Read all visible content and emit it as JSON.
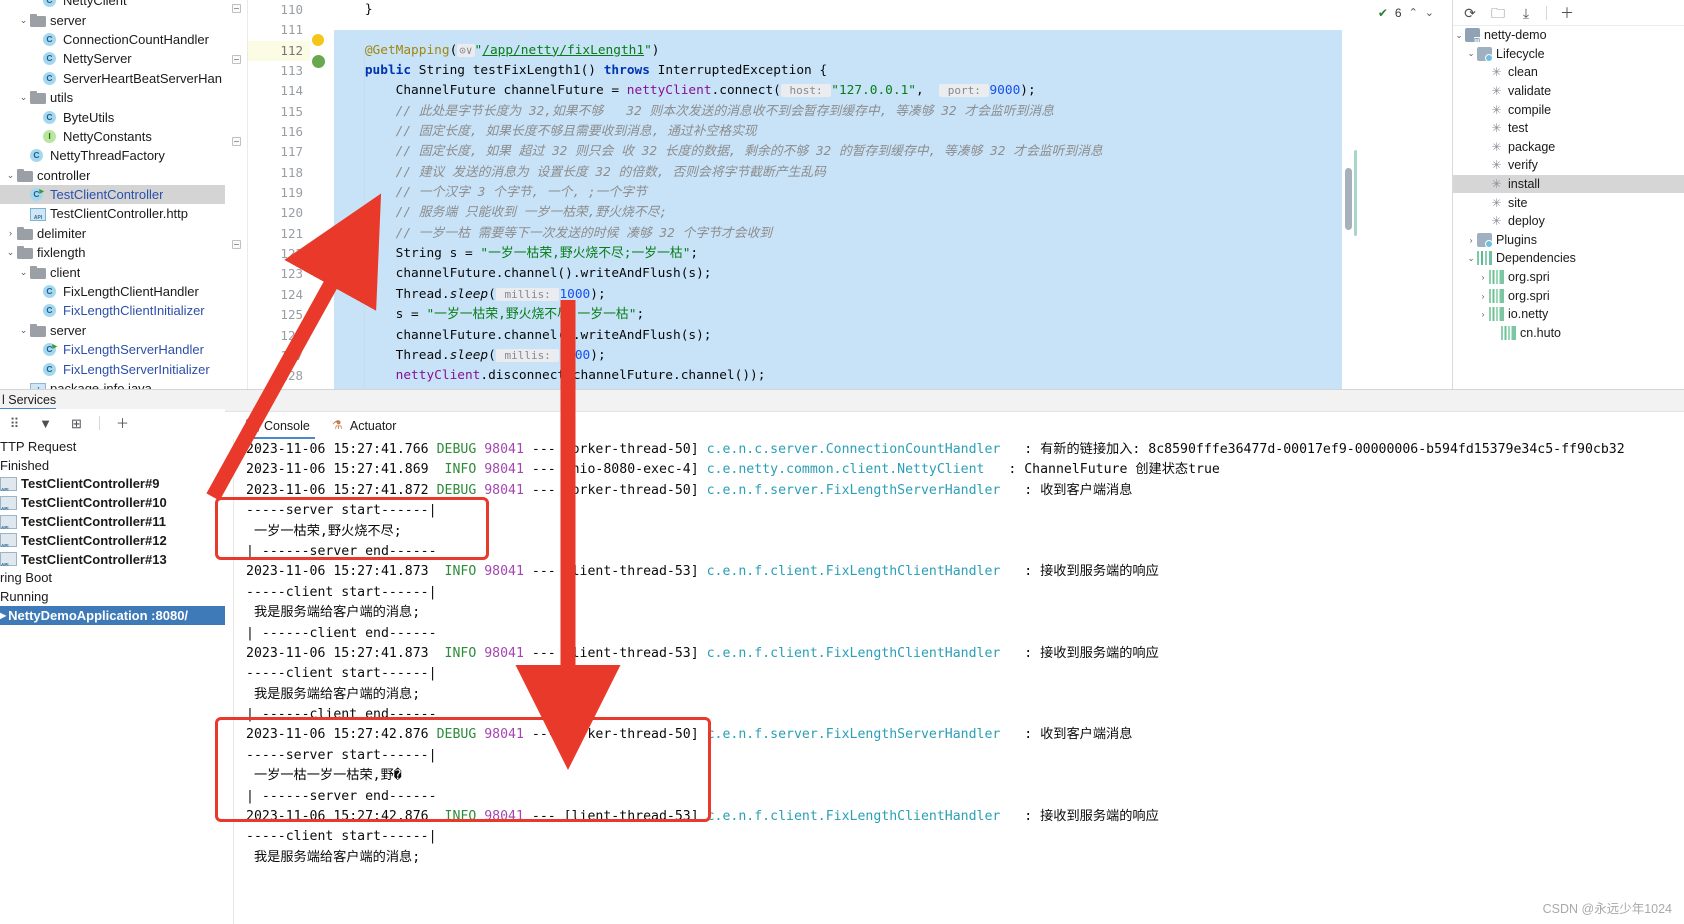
{
  "project_tree": {
    "rows": [
      {
        "indent": 2,
        "twisty": "",
        "icon": "class-icon",
        "label": "NettyClient",
        "blue": false,
        "clipped_top": true
      },
      {
        "indent": 1,
        "twisty": "v",
        "icon": "folder-icon",
        "label": "server",
        "blue": false
      },
      {
        "indent": 2,
        "twisty": "",
        "icon": "class-icon",
        "label": "ConnectionCountHandler",
        "blue": false
      },
      {
        "indent": 2,
        "twisty": "",
        "icon": "class-icon",
        "label": "NettyServer",
        "blue": false
      },
      {
        "indent": 2,
        "twisty": "",
        "icon": "class-icon",
        "label": "ServerHeartBeatServerHan",
        "blue": false
      },
      {
        "indent": 1,
        "twisty": "v",
        "icon": "folder-icon",
        "label": "utils",
        "blue": false
      },
      {
        "indent": 2,
        "twisty": "",
        "icon": "class-icon",
        "label": "ByteUtils",
        "blue": false
      },
      {
        "indent": 2,
        "twisty": "",
        "icon": "interface-icon",
        "label": "NettyConstants",
        "blue": false
      },
      {
        "indent": 1,
        "twisty": "",
        "icon": "class-icon",
        "label": "NettyThreadFactory",
        "blue": false
      },
      {
        "indent": 0,
        "twisty": "v",
        "icon": "folder-icon",
        "label": "controller",
        "blue": false
      },
      {
        "indent": 1,
        "twisty": "",
        "icon": "class-runnable-icon",
        "label": "TestClientController",
        "blue": true,
        "selected": true
      },
      {
        "indent": 1,
        "twisty": "",
        "icon": "http-file-icon",
        "label": "TestClientController.http",
        "blue": false
      },
      {
        "indent": 0,
        "twisty": ">",
        "icon": "folder-icon",
        "label": "delimiter",
        "blue": false
      },
      {
        "indent": 0,
        "twisty": "v",
        "icon": "folder-icon",
        "label": "fixlength",
        "blue": false
      },
      {
        "indent": 1,
        "twisty": "v",
        "icon": "folder-icon",
        "label": "client",
        "blue": false
      },
      {
        "indent": 2,
        "twisty": "",
        "icon": "class-icon",
        "label": "FixLengthClientHandler",
        "blue": false
      },
      {
        "indent": 2,
        "twisty": "",
        "icon": "class-icon",
        "label": "FixLengthClientInitializer",
        "blue": true
      },
      {
        "indent": 1,
        "twisty": "v",
        "icon": "folder-icon",
        "label": "server",
        "blue": false
      },
      {
        "indent": 2,
        "twisty": "",
        "icon": "class-runnable-icon",
        "label": "FixLengthServerHandler",
        "blue": true
      },
      {
        "indent": 2,
        "twisty": "",
        "icon": "class-icon",
        "label": "FixLengthServerInitializer",
        "blue": true
      },
      {
        "indent": 1,
        "twisty": "",
        "icon": "package-info-icon",
        "label": "package-info.java",
        "blue": false
      }
    ]
  },
  "editor": {
    "inspection_count": "6",
    "inspection_icon": "inspection-ok-icon",
    "up_icon": "chevron-up-icon",
    "down_icon": "chevron-down-icon",
    "gutter_first_visible": "110",
    "line_numbers": [
      "110",
      "111",
      "112",
      "113",
      "114",
      "115",
      "116",
      "117",
      "118",
      "119",
      "120",
      "121",
      "122",
      "123",
      "124",
      "125",
      "126",
      "127",
      "128"
    ],
    "current_line": "112",
    "bookmark_line": "113",
    "lines": [
      {
        "n": "110",
        "segs": [
          {
            "t": "    }",
            "c": ""
          }
        ]
      },
      {
        "n": "111",
        "segs": []
      },
      {
        "n": "112",
        "segs": [
          {
            "t": "    ",
            "c": ""
          },
          {
            "t": "@GetMapping",
            "c": "ann"
          },
          {
            "t": "(",
            "c": ""
          },
          {
            "t": "⊙∨",
            "c": "hint"
          },
          {
            "t": "\"",
            "c": "str"
          },
          {
            "t": "/app/netty/fixLength1",
            "c": "lnk"
          },
          {
            "t": "\"",
            "c": "str"
          },
          {
            "t": ")",
            "c": ""
          }
        ]
      },
      {
        "n": "113",
        "segs": [
          {
            "t": "    ",
            "c": ""
          },
          {
            "t": "public",
            "c": "kw"
          },
          {
            "t": " String ",
            "c": ""
          },
          {
            "t": "testFixLength1",
            "c": ""
          },
          {
            "t": "() ",
            "c": ""
          },
          {
            "t": "throws",
            "c": "kw"
          },
          {
            "t": " InterruptedException {",
            "c": ""
          }
        ]
      },
      {
        "n": "114",
        "segs": [
          {
            "t": "        ChannelFuture channelFuture = ",
            "c": ""
          },
          {
            "t": "nettyClient",
            "c": "fld"
          },
          {
            "t": ".connect(",
            "c": ""
          },
          {
            "t": " host: ",
            "c": "hint"
          },
          {
            "t": "\"127.0.0.1\"",
            "c": "str"
          },
          {
            "t": ",  ",
            "c": ""
          },
          {
            "t": " port: ",
            "c": "hint"
          },
          {
            "t": "9000",
            "c": "num"
          },
          {
            "t": ");",
            "c": ""
          }
        ]
      },
      {
        "n": "115",
        "segs": [
          {
            "t": "        // 此处是字节长度为 32,如果不够   32 则本次发送的消息收不到会暂存到缓存中, 等凑够 32 才会监听到消息",
            "c": "cmt"
          }
        ]
      },
      {
        "n": "116",
        "segs": [
          {
            "t": "        // 固定长度, 如果长度不够且需要收到消息, 通过补空格实现",
            "c": "cmt"
          }
        ]
      },
      {
        "n": "117",
        "segs": [
          {
            "t": "        // 固定长度, 如果 超过 32 则只会 收 32 长度的数据, 剩余的不够 32 的暂存到缓存中, 等凑够 32 才会监听到消息",
            "c": "cmt"
          }
        ]
      },
      {
        "n": "118",
        "segs": [
          {
            "t": "        // 建议 发送的消息为 设置长度 32 的倍数, 否则会将字节截断产生乱码",
            "c": "cmt"
          }
        ]
      },
      {
        "n": "119",
        "segs": [
          {
            "t": "        // 一个汉字 3 个字节, 一个, ;一个字节",
            "c": "cmt"
          }
        ]
      },
      {
        "n": "120",
        "segs": [
          {
            "t": "        // 服务端 只能收到 一岁一枯荣,野火烧不尽;",
            "c": "cmt"
          }
        ]
      },
      {
        "n": "121",
        "segs": [
          {
            "t": "        // 一岁一枯 需要等下一次发送的时候 凑够 32 个字节才会收到",
            "c": "cmt"
          }
        ]
      },
      {
        "n": "122",
        "segs": [
          {
            "t": "        String ",
            "c": ""
          },
          {
            "t": "s",
            "c": ""
          },
          {
            "t": " = ",
            "c": ""
          },
          {
            "t": "\"一岁一枯荣,野火烧不尽;一岁一枯\"",
            "c": "str"
          },
          {
            "t": ";",
            "c": ""
          }
        ]
      },
      {
        "n": "123",
        "segs": [
          {
            "t": "        channelFuture.channel().writeAndFlush(s);",
            "c": ""
          }
        ]
      },
      {
        "n": "124",
        "segs": [
          {
            "t": "        Thread.",
            "c": ""
          },
          {
            "t": "sleep",
            "c": "itl"
          },
          {
            "t": "(",
            "c": ""
          },
          {
            "t": " millis: ",
            "c": "hint"
          },
          {
            "t": "1000",
            "c": "num"
          },
          {
            "t": ");",
            "c": ""
          }
        ]
      },
      {
        "n": "125",
        "segs": [
          {
            "t": "        s = ",
            "c": ""
          },
          {
            "t": "\"一岁一枯荣,野火烧不尽;一岁一枯\"",
            "c": "str"
          },
          {
            "t": ";",
            "c": ""
          }
        ]
      },
      {
        "n": "126",
        "segs": [
          {
            "t": "        channelFuture.channel().writeAndFlush(s);",
            "c": ""
          }
        ]
      },
      {
        "n": "127",
        "segs": [
          {
            "t": "        Thread.",
            "c": ""
          },
          {
            "t": "sleep",
            "c": "itl"
          },
          {
            "t": "(",
            "c": ""
          },
          {
            "t": " millis: ",
            "c": "hint"
          },
          {
            "t": "1000",
            "c": "num"
          },
          {
            "t": ");",
            "c": ""
          }
        ]
      },
      {
        "n": "128",
        "segs": [
          {
            "t": "        ",
            "c": ""
          },
          {
            "t": "nettyClient",
            "c": "fld"
          },
          {
            "t": ".disconnect(channelFuture.channel());",
            "c": ""
          }
        ]
      }
    ]
  },
  "maven": {
    "toolbar_icons": [
      "refresh-icon",
      "add-maven-project-icon",
      "download-sources-icon",
      "add-icon"
    ],
    "rows": [
      {
        "indent": 0,
        "twisty": "v",
        "icon": "maven-project-icon",
        "label": "netty-demo"
      },
      {
        "indent": 1,
        "twisty": "v",
        "icon": "lifecycle-folder-icon",
        "label": "Lifecycle"
      },
      {
        "indent": 2,
        "twisty": "",
        "icon": "gear-icon",
        "label": "clean"
      },
      {
        "indent": 2,
        "twisty": "",
        "icon": "gear-icon",
        "label": "validate"
      },
      {
        "indent": 2,
        "twisty": "",
        "icon": "gear-icon",
        "label": "compile"
      },
      {
        "indent": 2,
        "twisty": "",
        "icon": "gear-icon",
        "label": "test"
      },
      {
        "indent": 2,
        "twisty": "",
        "icon": "gear-icon",
        "label": "package"
      },
      {
        "indent": 2,
        "twisty": "",
        "icon": "gear-icon",
        "label": "verify"
      },
      {
        "indent": 2,
        "twisty": "",
        "icon": "gear-icon",
        "label": "install",
        "selected": true
      },
      {
        "indent": 2,
        "twisty": "",
        "icon": "gear-icon",
        "label": "site"
      },
      {
        "indent": 2,
        "twisty": "",
        "icon": "gear-icon",
        "label": "deploy"
      },
      {
        "indent": 1,
        "twisty": ">",
        "icon": "plugins-folder-icon",
        "label": "Plugins"
      },
      {
        "indent": 1,
        "twisty": "v",
        "icon": "dependencies-icon",
        "label": "Dependencies"
      },
      {
        "indent": 2,
        "twisty": ">",
        "icon": "library-icon",
        "label": "org.spri"
      },
      {
        "indent": 2,
        "twisty": ">",
        "icon": "library-icon",
        "label": "org.spri"
      },
      {
        "indent": 2,
        "twisty": ">",
        "icon": "library-icon",
        "label": "io.netty"
      },
      {
        "indent": 3,
        "twisty": "",
        "icon": "library-icon",
        "label": "cn.huto"
      }
    ]
  },
  "services": {
    "tab_label": "l Services",
    "toolbar_icons": [
      "group-by-icon",
      "filter-icon",
      "new-tab-icon",
      "add-icon"
    ],
    "rows": [
      {
        "label": "TTP Request",
        "icon": "",
        "bold": false
      },
      {
        "label": "Finished",
        "icon": "",
        "bold": false
      },
      {
        "label": "TestClientController#9",
        "icon": "http-request-icon",
        "bold": true
      },
      {
        "label": "TestClientController#10",
        "icon": "http-request-icon",
        "bold": true
      },
      {
        "label": "TestClientController#11",
        "icon": "http-request-icon",
        "bold": true
      },
      {
        "label": "TestClientController#12",
        "icon": "http-request-icon",
        "bold": true
      },
      {
        "label": "TestClientController#13",
        "icon": "http-request-icon",
        "bold": true
      },
      {
        "label": "ring Boot",
        "icon": "",
        "bold": false
      },
      {
        "label": "Running",
        "icon": "",
        "bold": false
      },
      {
        "label": "NettyDemoApplication :8080/",
        "icon": "run-icon",
        "bold": true,
        "running": true
      }
    ]
  },
  "console": {
    "tabs": [
      {
        "label": "Console",
        "icon": "console-icon",
        "active": true
      },
      {
        "label": "Actuator",
        "icon": "actuator-icon",
        "active": false
      }
    ],
    "lines": [
      {
        "type": "log",
        "date": "2023-11-06 15:27:41.766",
        "level": "DEBUG",
        "pid": "98041",
        "sep": "---",
        "thread": "[orker-thread-50]",
        "logger": "c.e.n.c.server.ConnectionCountHandler",
        "msg": ": 有新的链接加入: 8c8590fffe36477d-00017ef9-00000006-b594fd15379e34c5-ff90cb32"
      },
      {
        "type": "log",
        "date": "2023-11-06 15:27:41.869",
        "level": " INFO",
        "pid": "98041",
        "sep": "---",
        "thread": "[nio-8080-exec-4]",
        "logger": "c.e.netty.common.client.NettyClient",
        "msg": ": ChannelFuture 创建状态true"
      },
      {
        "type": "log",
        "date": "2023-11-06 15:27:41.872",
        "level": "DEBUG",
        "pid": "98041",
        "sep": "---",
        "thread": "[orker-thread-50]",
        "logger": "c.e.n.f.server.FixLengthServerHandler",
        "msg": ": 收到客户端消息"
      },
      {
        "type": "plain",
        "text": "-----server start------|"
      },
      {
        "type": "plain",
        "text": " 一岁一枯荣,野火烧不尽;"
      },
      {
        "type": "plain",
        "text": "| ------server end------"
      },
      {
        "type": "log",
        "date": "2023-11-06 15:27:41.873",
        "level": " INFO",
        "pid": "98041",
        "sep": "---",
        "thread": "[lient-thread-53]",
        "logger": "c.e.n.f.client.FixLengthClientHandler",
        "msg": ": 接收到服务端的响应"
      },
      {
        "type": "plain",
        "text": "-----client start------|"
      },
      {
        "type": "plain",
        "text": " 我是服务端给客户端的消息;"
      },
      {
        "type": "plain",
        "text": "| ------client end------"
      },
      {
        "type": "log",
        "date": "2023-11-06 15:27:41.873",
        "level": " INFO",
        "pid": "98041",
        "sep": "---",
        "thread": "[lient-thread-53]",
        "logger": "c.e.n.f.client.FixLengthClientHandler",
        "msg": ": 接收到服务端的响应"
      },
      {
        "type": "plain",
        "text": "-----client start------|"
      },
      {
        "type": "plain",
        "text": " 我是服务端给客户端的消息;"
      },
      {
        "type": "plain",
        "text": "| ------client end------"
      },
      {
        "type": "log",
        "date": "2023-11-06 15:27:42.876",
        "level": "DEBUG",
        "pid": "98041",
        "sep": "---",
        "thread": "[orker-thread-50]",
        "logger": "c.e.n.f.server.FixLengthServerHandler",
        "msg": ": 收到客户端消息"
      },
      {
        "type": "plain",
        "text": "-----server start------|"
      },
      {
        "type": "plain",
        "text": " 一岁一枯一岁一枯荣,野�"
      },
      {
        "type": "plain",
        "text": "| ------server end------"
      },
      {
        "type": "log",
        "date": "2023-11-06 15:27:42.876",
        "level": " INFO",
        "pid": "98041",
        "sep": "---",
        "thread": "[lient-thread-53]",
        "logger": "c.e.n.f.client.FixLengthClientHandler",
        "msg": ": 接收到服务端的响应"
      },
      {
        "type": "plain",
        "text": "-----client start------|"
      },
      {
        "type": "plain",
        "text": " 我是服务端给客户端的消息;"
      }
    ]
  },
  "annotations": {
    "arrows": [
      "arrow-to-code-line-122",
      "arrow-down-to-log"
    ],
    "boxes": [
      "box-server-output-first",
      "box-server-output-second"
    ],
    "accent_red": "#e8392a"
  },
  "watermark": "CSDN @永远少年1024"
}
